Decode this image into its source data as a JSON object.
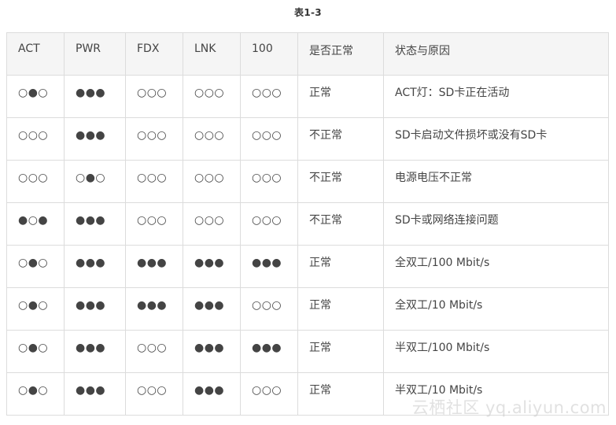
{
  "caption": "表1-3",
  "table": {
    "headers": [
      "ACT",
      "PWR",
      "FDX",
      "LNK",
      "100",
      "是否正常",
      "状态与原因"
    ],
    "rows": [
      [
        "○●○",
        "●●●",
        "○○○",
        "○○○",
        "○○○",
        "正常",
        "ACT灯：SD卡正在活动"
      ],
      [
        "○○○",
        "●●●",
        "○○○",
        "○○○",
        "○○○",
        "不正常",
        "SD卡启动文件损坏或没有SD卡"
      ],
      [
        "○○○",
        "○●○",
        "○○○",
        "○○○",
        "○○○",
        "不正常",
        "电源电压不正常"
      ],
      [
        "●○●",
        "●●●",
        "○○○",
        "○○○",
        "○○○",
        "不正常",
        "SD卡或网络连接问题"
      ],
      [
        "○●○",
        "●●●",
        "●●●",
        "●●●",
        "●●●",
        "正常",
        "全双工/100 Mbit/s"
      ],
      [
        "○●○",
        "●●●",
        "●●●",
        "●●●",
        "○○○",
        "正常",
        "全双工/10 Mbit/s"
      ],
      [
        "○●○",
        "●●●",
        "○○○",
        "●●●",
        "●●●",
        "正常",
        "半双工/100 Mbit/s"
      ],
      [
        "○●○",
        "●●●",
        "○○○",
        "●●●",
        "○○○",
        "正常",
        "半双工/10 Mbit/s"
      ]
    ]
  },
  "watermark": "云栖社区 yq.aliyun.com"
}
